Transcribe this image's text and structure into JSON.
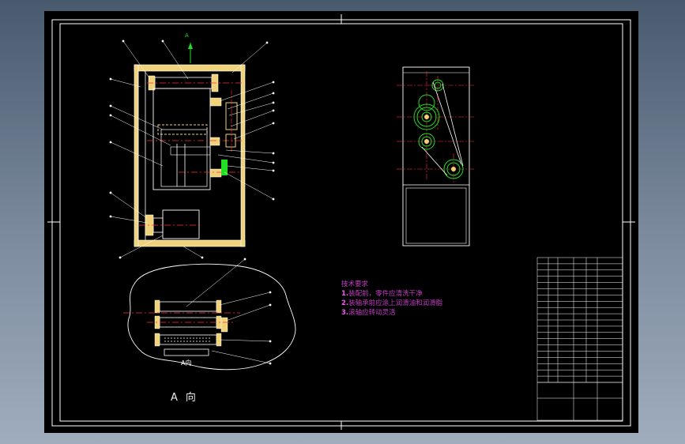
{
  "drawing": {
    "tech_title": "技术要求",
    "notes": [
      {
        "num": "1.",
        "text": "装配前，零件应清洗干净"
      },
      {
        "num": "2.",
        "text": "装轴承前应涂上润滑油和润滑脂"
      },
      {
        "num": "3.",
        "text": "滚轴应转动灵活"
      }
    ],
    "section_label": "A",
    "view_label_a": "A",
    "view_label_dir": "向",
    "inset_label": "A向"
  },
  "colors": {
    "canvas": "#000000",
    "frame": "#ffffff",
    "wall": "#f0d27a",
    "center": "#ff3030",
    "green": "#22dd22",
    "magenta": "#c43cc4"
  }
}
